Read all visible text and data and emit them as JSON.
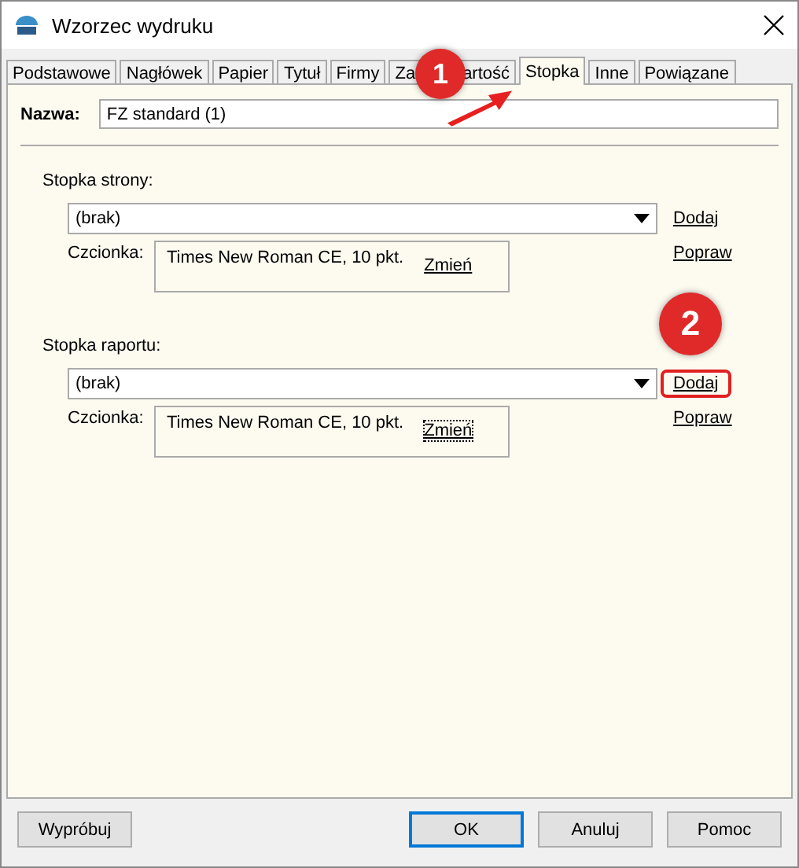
{
  "window": {
    "title": "Wzorzec wydruku"
  },
  "tabs": [
    {
      "label": "Podstawowe",
      "selected": false
    },
    {
      "label": "Nagłówek",
      "selected": false
    },
    {
      "label": "Papier",
      "selected": false
    },
    {
      "label": "Tytuł",
      "selected": false
    },
    {
      "label": "Firmy",
      "selected": false
    },
    {
      "label": "Za",
      "label_rest": "artość",
      "selected": false
    },
    {
      "label": "Stopka",
      "selected": true
    },
    {
      "label": "Inne",
      "selected": false
    },
    {
      "label": "Powiązane",
      "selected": false
    }
  ],
  "name_field": {
    "label": "Nazwa:",
    "value": "FZ standard (1)"
  },
  "sections": [
    {
      "label": "Stopka strony:",
      "combo_value": "(brak)",
      "add_link": "Dodaj",
      "add_highlighted": false,
      "font_label": "Czcionka:",
      "font_value": "Times New Roman CE, 10 pkt.",
      "change_link": "Zmień",
      "change_focused": false,
      "edit_link": "Popraw"
    },
    {
      "label": "Stopka raportu:",
      "combo_value": "(brak)",
      "add_link": "Dodaj",
      "add_highlighted": true,
      "font_label": "Czcionka:",
      "font_value": "Times New Roman CE, 10 pkt.",
      "change_link": "Zmień",
      "change_focused": true,
      "edit_link": "Popraw"
    }
  ],
  "buttons": [
    {
      "label": "Wypróbuj",
      "kind": "left"
    },
    {
      "label": "OK",
      "kind": "default"
    },
    {
      "label": "Anuluj",
      "kind": "right"
    },
    {
      "label": "Pomoc",
      "kind": "right"
    }
  ],
  "annotations": [
    {
      "number": "1",
      "kind": "tab"
    },
    {
      "number": "2",
      "kind": "link"
    }
  ]
}
